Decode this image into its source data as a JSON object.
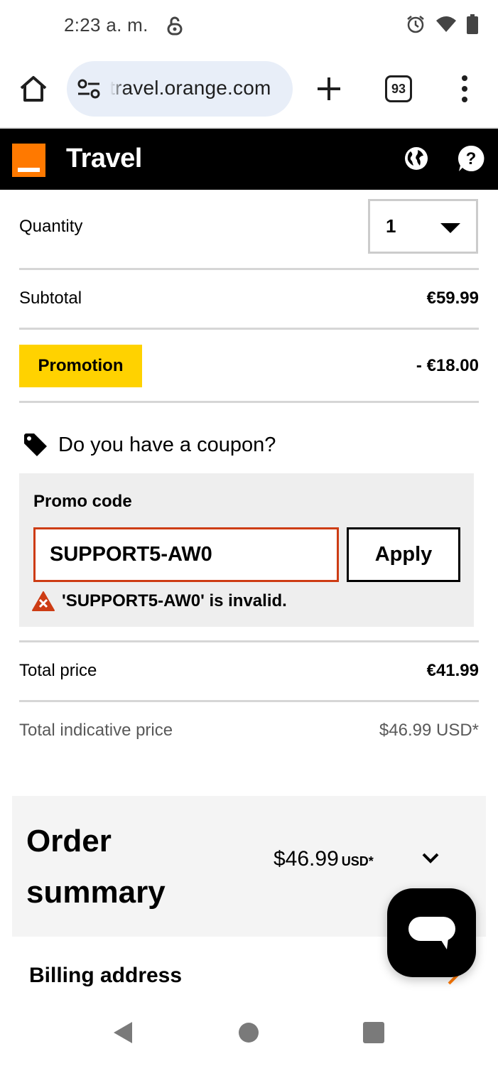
{
  "status_bar": {
    "time": "2:23 a. m."
  },
  "browser": {
    "url": "travel.orange.com",
    "tab_count": "93"
  },
  "header": {
    "title": "Travel",
    "brand_color": "#ff7900"
  },
  "cart": {
    "quantity_label": "Quantity",
    "quantity_value": "1",
    "subtotal_label": "Subtotal",
    "subtotal_value": "€59.99",
    "promotion_label": "Promotion",
    "promotion_value": "- €18.00",
    "coupon_question": "Do you have a coupon?",
    "promo_code_label": "Promo code",
    "promo_code_value": "SUPPORT5-AW0",
    "apply_label": "Apply",
    "error_message": "'SUPPORT5-AW0' is invalid.",
    "total_label": "Total price",
    "total_value": "€41.99",
    "indicative_label": "Total indicative price",
    "indicative_value": "$46.99 USD*"
  },
  "order_summary": {
    "title": "Order summary",
    "amount": "$46.99",
    "currency": "USD*"
  },
  "billing": {
    "title": "Billing address"
  },
  "colors": {
    "error": "#cd3c14",
    "promotion": "#ffd200",
    "header_bg": "#000000"
  }
}
